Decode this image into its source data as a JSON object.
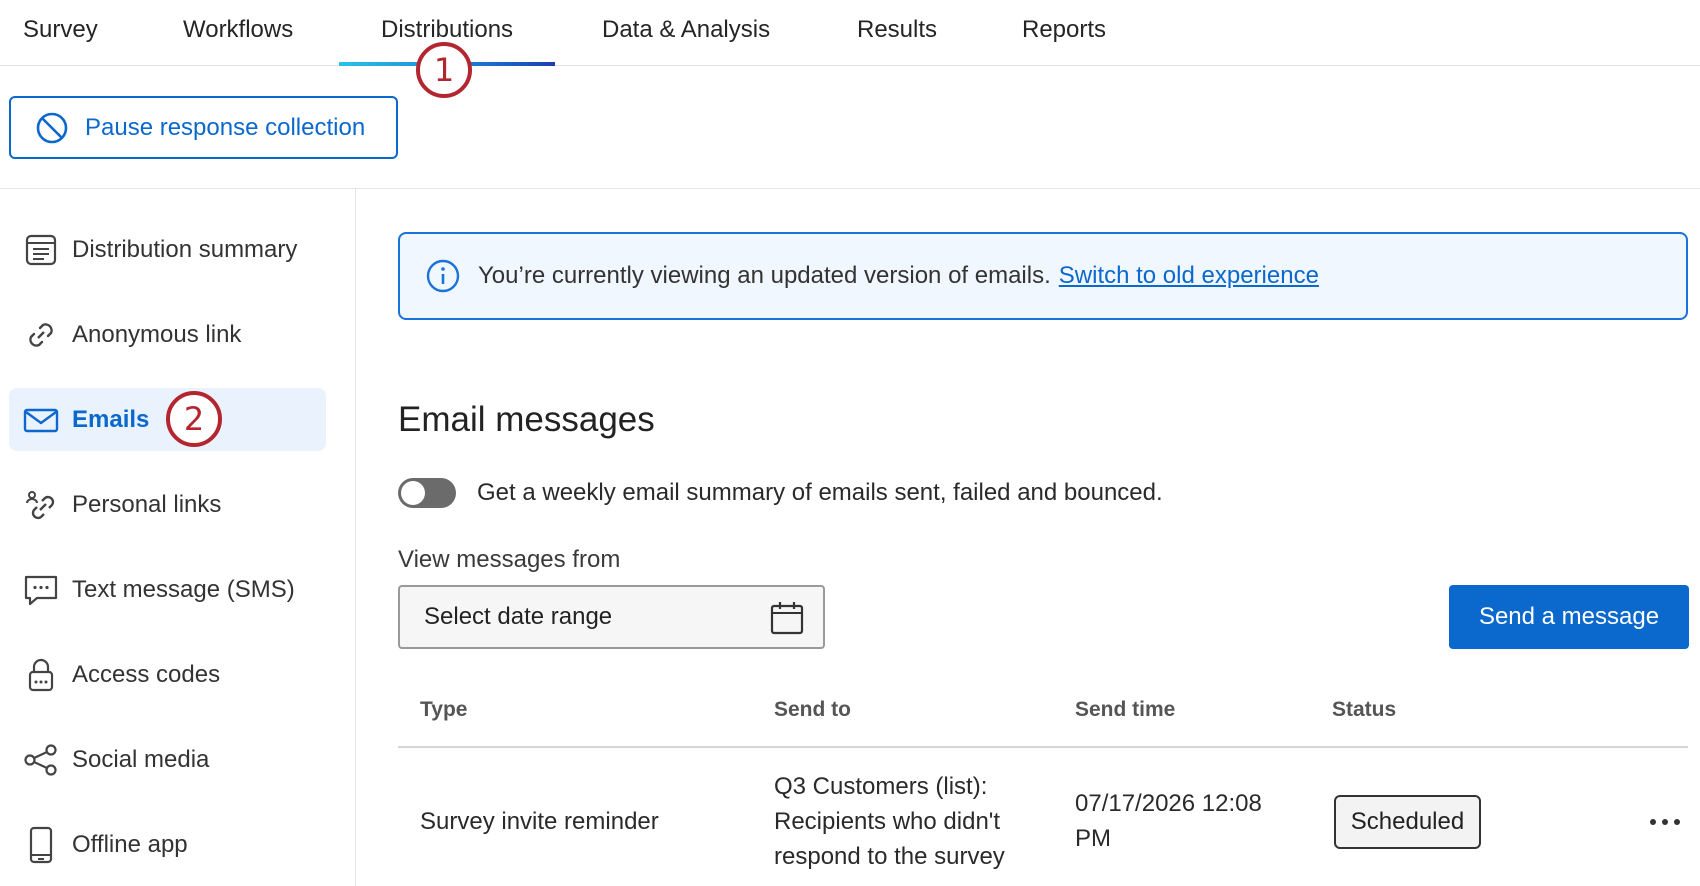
{
  "top_nav": {
    "tabs": [
      {
        "label": "Survey"
      },
      {
        "label": "Workflows"
      },
      {
        "label": "Distributions",
        "active": true
      },
      {
        "label": "Data & Analysis"
      },
      {
        "label": "Results"
      },
      {
        "label": "Reports"
      }
    ]
  },
  "markers": [
    "1",
    "2"
  ],
  "pause_button": {
    "label": "Pause response collection",
    "icon": "ban-icon"
  },
  "sidebar": {
    "items": [
      {
        "label": "Distribution summary",
        "icon": "summary-icon"
      },
      {
        "label": "Anonymous link",
        "icon": "link-icon"
      },
      {
        "label": "Emails",
        "icon": "mail-icon",
        "active": true
      },
      {
        "label": "Personal links",
        "icon": "personal-link-icon"
      },
      {
        "label": "Text message (SMS)",
        "icon": "sms-icon"
      },
      {
        "label": "Access codes",
        "icon": "lock-icon"
      },
      {
        "label": "Social media",
        "icon": "share-icon"
      },
      {
        "label": "Offline app",
        "icon": "phone-icon"
      }
    ]
  },
  "banner": {
    "text": "You’re currently viewing an updated version of emails.",
    "link": "Switch to old experience",
    "icon": "info-icon"
  },
  "main": {
    "title": "Email messages",
    "toggle_label": "Get a weekly email summary of emails sent, failed and bounced.",
    "toggle_on": false,
    "date_label": "View messages from",
    "date_placeholder": "Select date range",
    "send_button": "Send a message"
  },
  "table": {
    "headers": [
      "Type",
      "Send to",
      "Send time",
      "Status"
    ],
    "rows": [
      {
        "type": "Survey invite reminder",
        "send_to": "Q3 Customers (list): Recipients who didn't respond to the survey",
        "send_time": "07/17/2026 12:08 PM",
        "status": "Scheduled"
      }
    ]
  },
  "colors": {
    "accent": "#0b68cd",
    "marker": "#b3262f",
    "active_bg": "#e9f2fd"
  }
}
